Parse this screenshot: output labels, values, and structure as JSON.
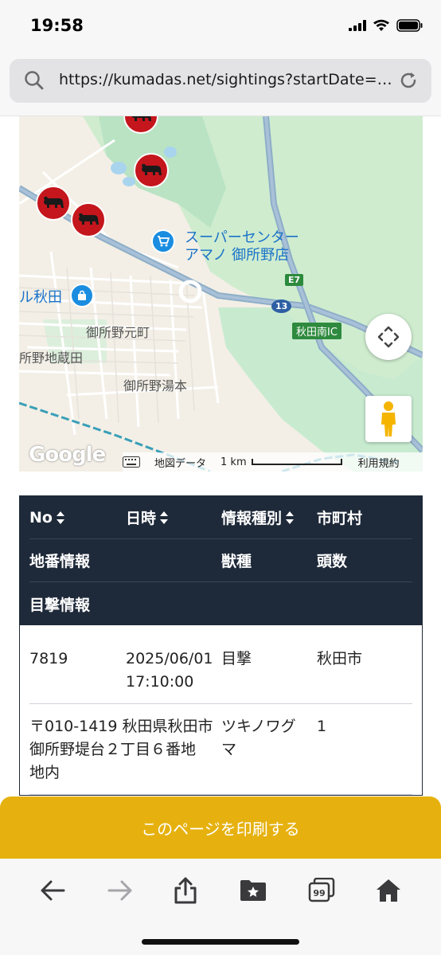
{
  "status_bar": {
    "time": "19:58"
  },
  "browser": {
    "url": "https://kumadas.net/sightings?startDate=&..."
  },
  "map": {
    "labels": {
      "poi_supercenter": "スーパーセンター",
      "poi_supercenter_2": "アマノ 御所野店",
      "poi_akita": "ル秋田",
      "area_motomachi": "御所野元町",
      "area_jizoden": "所野地蔵田",
      "area_yumoto": "御所野湯本",
      "road_e7": "E7",
      "road_13": "13",
      "ic_label": "秋田南IC"
    },
    "footer": {
      "map_data": "地図データ",
      "scale": "1 km",
      "terms": "利用規約"
    },
    "google_logo": "Google",
    "marker_color": "#c4161c"
  },
  "table": {
    "header_row1": [
      "No",
      "日時",
      "情報種別",
      "市町村"
    ],
    "header_row2": [
      "地番情報",
      "",
      "獣種",
      "頭数"
    ],
    "header_row3": [
      "目撃情報"
    ],
    "record": {
      "no": "7819",
      "date": "2025/06/01",
      "time": "17:10:00",
      "type": "目撃",
      "city": "秋田市",
      "address_line1": "〒010-1419 秋田県秋田市",
      "address_line2": "御所野堤台２丁目６番地",
      "address_line3": "地内",
      "species_line1": "ツキノワグ",
      "species_line2": "マ",
      "count": "1"
    }
  },
  "print_button": {
    "label": "このページを印刷する",
    "color": "#e6b10f"
  }
}
